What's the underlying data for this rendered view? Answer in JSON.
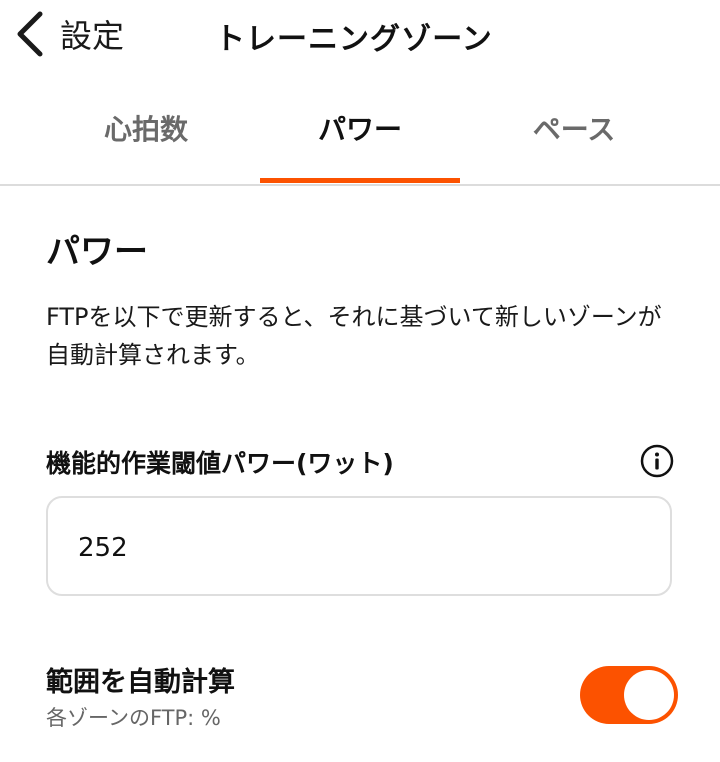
{
  "header": {
    "back_label": "設定",
    "title": "トレーニングゾーン"
  },
  "tabs": [
    {
      "label": "心拍数",
      "active": false
    },
    {
      "label": "パワー",
      "active": true
    },
    {
      "label": "ペース",
      "active": false
    }
  ],
  "colors": {
    "accent": "#fc5200"
  },
  "section": {
    "title": "パワー",
    "description": "FTPを以下で更新すると、それに基づいて新しいゾーンが自動計算されます。"
  },
  "ftp_field": {
    "label": "機能的作業閾値パワー(ワット)",
    "value": "252",
    "info_icon": "info-circle-icon"
  },
  "auto_calc": {
    "title": "範囲を自動計算",
    "subtitle": "各ゾーンのFTP: %",
    "enabled": true
  }
}
